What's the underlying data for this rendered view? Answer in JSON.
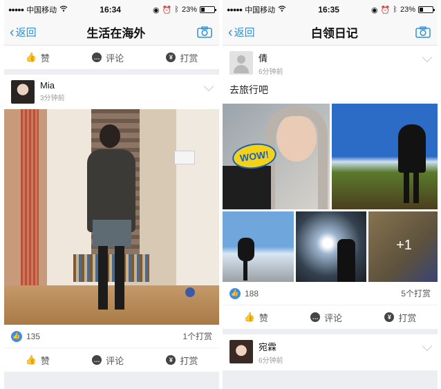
{
  "status_bar": {
    "carrier": "中国移动",
    "battery": "23%",
    "battery_level": 0.23,
    "left_time": "16:34",
    "right_time": "16:35"
  },
  "left": {
    "nav": {
      "back": "返回",
      "title": "生活在海外"
    },
    "top_actions": {
      "like": "赞",
      "comment": "评论",
      "tip": "打赏"
    },
    "post": {
      "name": "Mia",
      "time": "3分钟前",
      "likes": "135",
      "tips": "1个打赏"
    },
    "bottom_actions": {
      "like": "赞",
      "comment": "评论",
      "tip": "打赏"
    }
  },
  "right": {
    "nav": {
      "back": "返回",
      "title": "白领日记"
    },
    "post": {
      "name": "倩",
      "time": "6分钟前",
      "text": "去旅行吧",
      "sticker": "WOW!",
      "more_photos": "+1",
      "likes": "188",
      "tips": "5个打赏"
    },
    "actions": {
      "like": "赞",
      "comment": "评论",
      "tip": "打赏"
    },
    "next_post": {
      "name": "宛霖",
      "time": "6分钟前"
    }
  },
  "colors": {
    "accent": "#2e8fd8",
    "like": "#3b8ee6",
    "background": "#eceef1"
  },
  "icons": [
    "signal-dots-icon",
    "wifi-icon",
    "battery-icon",
    "back-chevron-icon",
    "camera-icon",
    "thumbs-up-icon",
    "comment-icon",
    "yen-icon",
    "chevron-down-icon",
    "like-badge-icon"
  ]
}
